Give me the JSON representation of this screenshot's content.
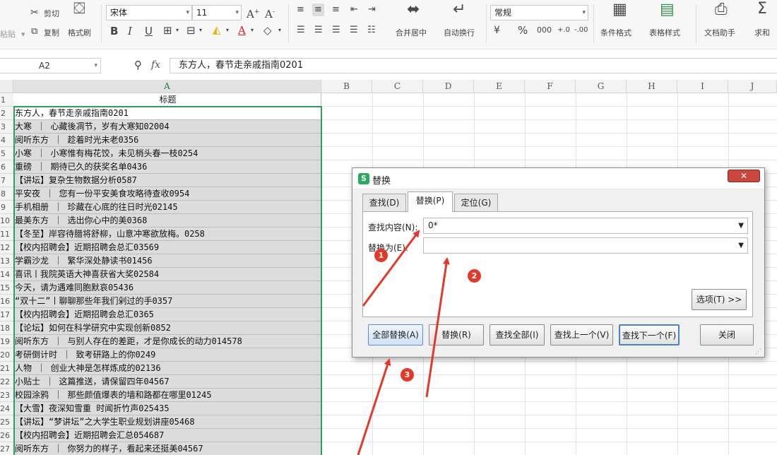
{
  "ribbon": {
    "paste": "粘贴",
    "cut": "剪切",
    "copy": "复制",
    "format_painter": "格式刷",
    "font_name": "宋体",
    "font_size": "11",
    "merge_center": "合并居中",
    "auto_wrap": "自动换行",
    "number_format": "常规",
    "conditional_format": "条件格式",
    "table_style": "表格样式",
    "doc_assistant": "文档助手",
    "sum": "求和"
  },
  "formula_bar": {
    "name_box": "A2",
    "fx": "fx",
    "content": "东方人，春节走亲戚指南0201"
  },
  "columns": [
    "A",
    "B",
    "C",
    "D",
    "E",
    "F",
    "G",
    "H",
    "I",
    "J"
  ],
  "rows": [
    {
      "num": "1",
      "a": "标题"
    },
    {
      "num": "2",
      "a": "东方人，春节走亲戚指南0201"
    },
    {
      "num": "3",
      "a": "大寒 ｜ 心藏後凋节，岁有大寒知02004"
    },
    {
      "num": "4",
      "a": "阅听东方 ｜ 趁着时光未老0356"
    },
    {
      "num": "5",
      "a": "小寒 ｜ 小寒惟有梅花饺，未见梢头春一枝0254"
    },
    {
      "num": "6",
      "a": "重磅 ｜ 期待已久的获奖名单0436"
    },
    {
      "num": "7",
      "a": "【讲坛】复杂生物数据分析0587"
    },
    {
      "num": "8",
      "a": "平安夜 ｜ 您有一份平安美食攻略待查收0954"
    },
    {
      "num": "9",
      "a": "手机相册 ｜ 珍藏在心底的往日时光02145"
    },
    {
      "num": "10",
      "a": "最美东方 ｜ 选出你心中的美0368"
    },
    {
      "num": "11",
      "a": "【冬至】岸容待腊将舒柳，山意冲寒欲放梅。0258"
    },
    {
      "num": "12",
      "a": "【校内招聘会】近期招聘会总汇03569"
    },
    {
      "num": "13",
      "a": "学霸沙龙 ｜ 繁华深处静读书01456"
    },
    {
      "num": "14",
      "a": "喜讯丨我院英语大神喜获省大奖02584"
    },
    {
      "num": "15",
      "a": "今天，请为遇难同胞默哀05436"
    },
    {
      "num": "16",
      "a": "“双十二”丨聊聊那些年我们剁过的手0357"
    },
    {
      "num": "17",
      "a": "【校内招聘会】近期招聘会总汇0365"
    },
    {
      "num": "18",
      "a": "【论坛】如何在科学研究中实现创新0852"
    },
    {
      "num": "19",
      "a": "阅听东方 ｜ 与别人存在的差距，才是你成长的动力014578"
    },
    {
      "num": "20",
      "a": "考研倒计时 ｜ 致考研路上的你0249"
    },
    {
      "num": "21",
      "a": "人物 ｜ 创业大神是怎样炼成的02136"
    },
    {
      "num": "22",
      "a": "小贴士 ｜ 这篇推送，请保留四年04567"
    },
    {
      "num": "23",
      "a": "校园涂鸦 ｜ 那些颜值爆表的墙和路都在哪里01245"
    },
    {
      "num": "24",
      "a": "【大雪】夜深知雪重 时闻折竹声025435"
    },
    {
      "num": "25",
      "a": "【讲坛】“梦讲坛”之大学生职业规划讲座05468"
    },
    {
      "num": "26",
      "a": "【校内招聘会】近期招聘会汇总054687"
    },
    {
      "num": "27",
      "a": "阅听东方 ｜ 你努力的样子，看起来还挺美04567"
    }
  ],
  "dialog": {
    "title": "替换",
    "close": "✕",
    "tabs": [
      "查找(D)",
      "替换(P)",
      "定位(G)"
    ],
    "find_label": "查找内容(N):",
    "find_value": "0*",
    "replace_label": "替换为(E):",
    "replace_value": "",
    "options_button": "选项(T) >>",
    "replace_all": "全部替换(A)",
    "replace": "替换(R)",
    "find_all": "查找全部(I)",
    "find_prev": "查找上一个(V)",
    "find_next": "查找下一个(F)",
    "close_button": "关闭"
  },
  "annotations": [
    "1",
    "2",
    "3"
  ],
  "colors": {
    "selection": "#2f9e59",
    "arrow": "#e23a2a",
    "wps_logo": "#2aaa5c"
  }
}
